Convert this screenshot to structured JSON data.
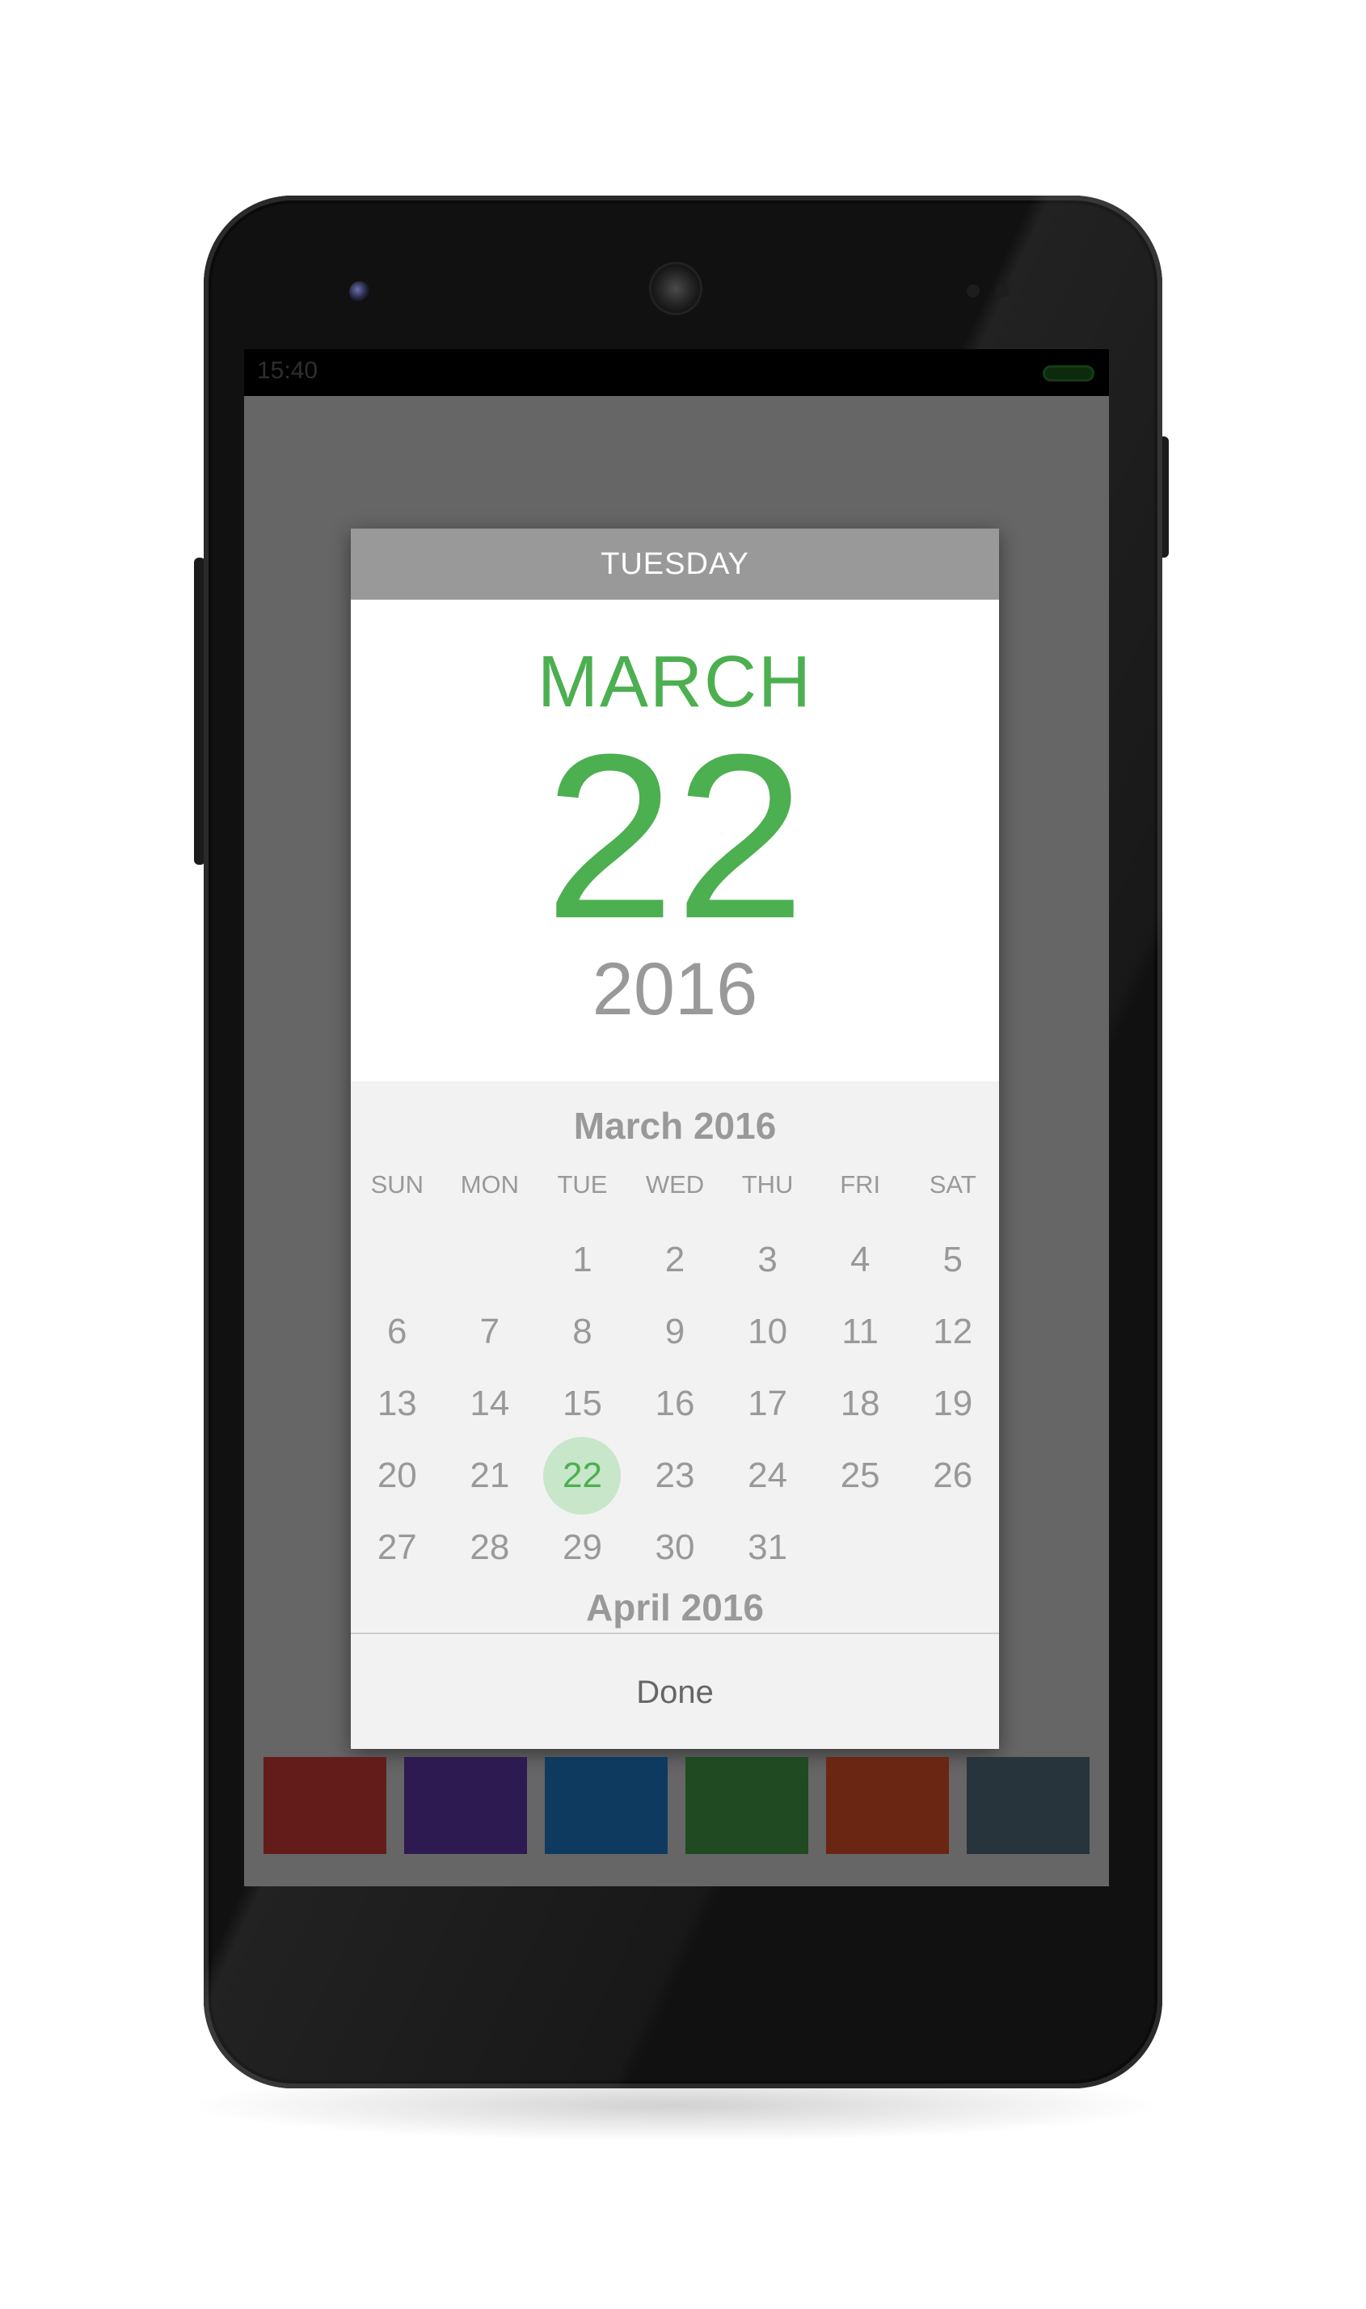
{
  "status_bar": {
    "time": "15:40"
  },
  "dialog": {
    "weekday_header": "TUESDAY",
    "selected": {
      "month": "MARCH",
      "day": "22",
      "year": "2016"
    },
    "calendar": {
      "month_title": "March 2016",
      "weekdays": [
        "SUN",
        "MON",
        "TUE",
        "WED",
        "THU",
        "FRI",
        "SAT"
      ],
      "weeks": [
        [
          "",
          "",
          "1",
          "2",
          "3",
          "4",
          "5"
        ],
        [
          "6",
          "7",
          "8",
          "9",
          "10",
          "11",
          "12"
        ],
        [
          "13",
          "14",
          "15",
          "16",
          "17",
          "18",
          "19"
        ],
        [
          "20",
          "21",
          "22",
          "23",
          "24",
          "25",
          "26"
        ],
        [
          "27",
          "28",
          "29",
          "30",
          "31",
          "",
          ""
        ]
      ],
      "selected_day": "22",
      "next_month_title": "April 2016"
    },
    "done_label": "Done"
  },
  "swatches": [
    {
      "name": "red",
      "color": "#641c1b"
    },
    {
      "name": "purple",
      "color": "#2c1a51"
    },
    {
      "name": "blue",
      "color": "#0f3a60"
    },
    {
      "name": "green",
      "color": "#1f4a22"
    },
    {
      "name": "orange",
      "color": "#6a2613"
    },
    {
      "name": "slate",
      "color": "#28343b"
    }
  ],
  "colors": {
    "accent": "#4caf50",
    "accent_light": "#c8e6c9",
    "header_bg": "#999999",
    "scrim": "#666666"
  }
}
